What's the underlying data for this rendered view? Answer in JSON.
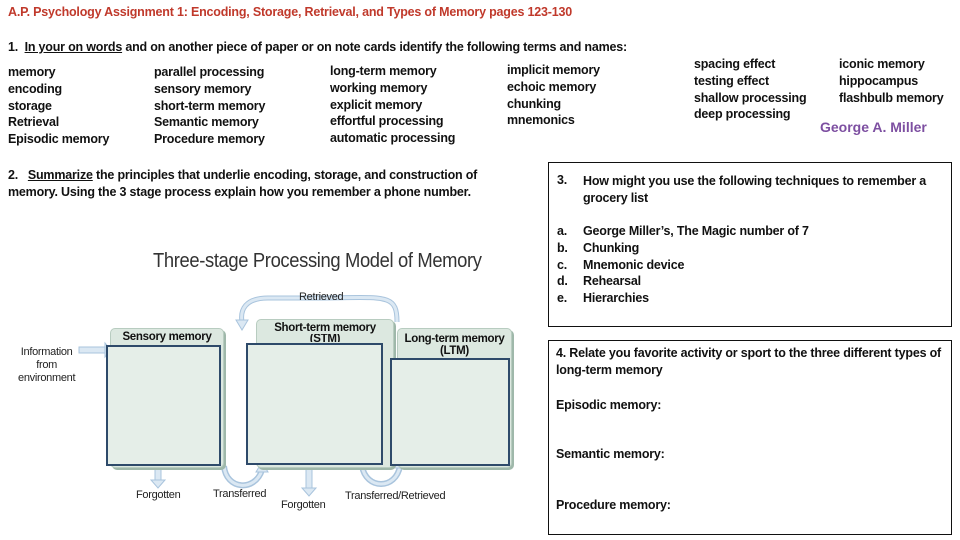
{
  "title": "A.P. Psychology Assignment 1:  Encoding, Storage, Retrieval, and Types of Memory  pages 123-130",
  "question1": {
    "number": "1.",
    "underlined": "In your on words",
    "rest": " and on another piece of paper or on note cards identify the following terms and names:",
    "columns": [
      [
        "memory",
        "encoding",
        "storage",
        "Retrieval",
        "Episodic memory"
      ],
      [
        "parallel processing",
        "sensory memory",
        "short-term memory",
        "Semantic memory",
        "Procedure memory"
      ],
      [
        "long-term memory",
        "working memory",
        "explicit memory",
        "effortful processing",
        "automatic processing"
      ],
      [
        "implicit memory",
        "echoic memory",
        "chunking",
        "mnemonics"
      ],
      [
        "spacing effect",
        "testing effect",
        "shallow processing",
        "deep processing"
      ],
      [
        "iconic memory",
        "hippocampus",
        "flashbulb memory"
      ]
    ],
    "name": "George A. Miller"
  },
  "question2": {
    "number": "2.",
    "underlined": "Summarize",
    "rest": " the principles that underlie encoding, storage, and construction of memory. Using the 3 stage process explain how you remember a phone number."
  },
  "diagram": {
    "title": "Three-stage Processing Model of Memory",
    "input_label": [
      "Information",
      "from",
      "environment"
    ],
    "retrieved_label": "Retrieved",
    "stages": [
      {
        "line1": "Sensory memory",
        "line2": ""
      },
      {
        "line1": "Short-term memory",
        "line2": "(STM)"
      },
      {
        "line1": "Long-term memory",
        "line2": "(LTM)"
      }
    ],
    "bottom_labels": {
      "forgotten1": "Forgotten",
      "transferred": "Transferred",
      "forgotten2": "Forgotten",
      "transferred_retrieved": "Transferred/Retrieved"
    },
    "colors": {
      "stage_fill": "#dce8e0",
      "inner_border": "#2e4a6a",
      "arrow": "#a9c4dd"
    }
  },
  "question3": {
    "number": "3.",
    "prompt": "How might you use the following techniques to remember a grocery list",
    "items": [
      {
        "letter": "a.",
        "text": "George Miller’s, The Magic number of 7"
      },
      {
        "letter": "b.",
        "text": "Chunking"
      },
      {
        "letter": "c.",
        "text": "Mnemonic device"
      },
      {
        "letter": "d.",
        "text": "Rehearsal"
      },
      {
        "letter": "e.",
        "text": "Hierarchies"
      }
    ]
  },
  "question4": {
    "prompt": "4.  Relate you favorite activity or sport to the three different types of long-term memory",
    "fields": [
      "Episodic memory:",
      "Semantic memory:",
      "Procedure memory:"
    ]
  },
  "colors": {
    "title": "#c0392b",
    "name_accent": "#7d4fa1"
  }
}
